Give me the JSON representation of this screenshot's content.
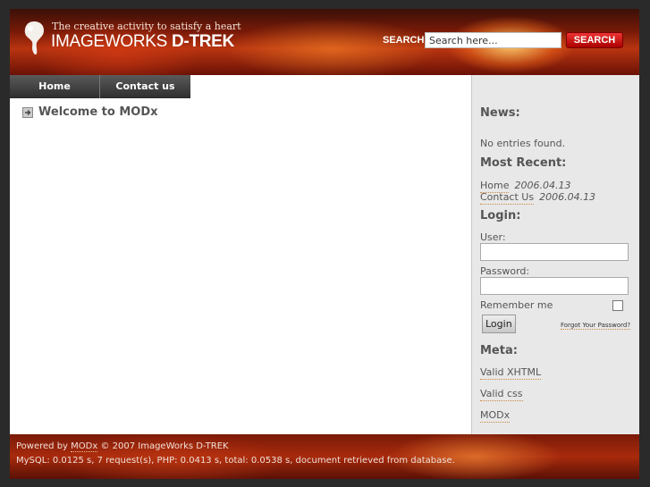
{
  "header": {
    "tagline": "The creative activity to satisfy a heart",
    "brand_part1": "IMAGEWORKS ",
    "brand_part2": "D-TREK",
    "logo_icon": "paint-drop-logo-icon"
  },
  "search": {
    "label": "SEARCH",
    "value": "Search here...",
    "button": "SEARCH"
  },
  "nav": {
    "items": [
      {
        "label": "Home"
      },
      {
        "label": "Contact us"
      }
    ]
  },
  "main": {
    "title": "Welcome to MODx",
    "title_icon": "arrow-right-icon"
  },
  "sidebar": {
    "news_heading": "News:",
    "news_text": "No entries found.",
    "recent_heading": "Most Recent:",
    "recent": [
      {
        "label": "Home",
        "date": "2006.04.13"
      },
      {
        "label": "Contact Us",
        "date": "2006.04.13"
      }
    ],
    "login_heading": "Login:",
    "user_label": "User:",
    "password_label": "Password:",
    "remember_label": "Remember me",
    "login_button": "Login",
    "forgot_link": "Forgot Your Password?",
    "meta_heading": "Meta:",
    "meta_links": [
      "Valid XHTML",
      "Valid css",
      "MODx"
    ]
  },
  "footer": {
    "powered_prefix": "Powered by ",
    "powered_link": "MODx",
    "copyright": " © 2007 ImageWorks D-TREK",
    "stats": "MySQL: 0.0125 s, 7 request(s), PHP: 0.0413 s, total: 0.0538 s, document retrieved from database."
  },
  "colors": {
    "header_red": "#b83410",
    "nav_dark": "#2e2e2e",
    "search_button": "#cc1111",
    "sidebar_bg": "#e8e8e8",
    "link_underline": "#cc8844"
  }
}
